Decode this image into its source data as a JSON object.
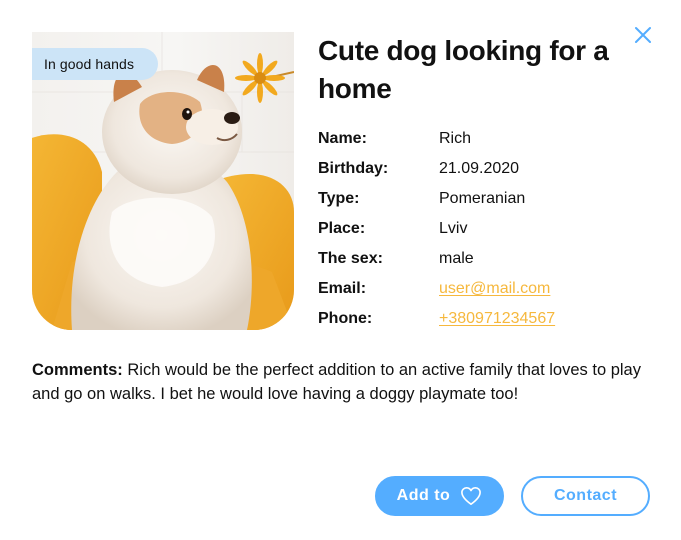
{
  "modal": {
    "title": "Cute dog looking for a home",
    "badge": "In good hands",
    "photo_alt": "Pomeranian dog looking at a yellow flower",
    "details": [
      {
        "label": "Name:",
        "value": "Rich"
      },
      {
        "label": "Birthday:",
        "value": "21.09.2020"
      },
      {
        "label": "Type:",
        "value": "Pomeranian"
      },
      {
        "label": "Place:",
        "value": "Lviv"
      },
      {
        "label": "The sex:",
        "value": "male"
      },
      {
        "label": "Email:",
        "value": "user@mail.com"
      },
      {
        "label": "Phone:",
        "value": "+380971234567"
      }
    ],
    "comments_label": "Comments:",
    "comments_text": "Rich would be the perfect addition to an active family that loves to play and go on walks. I bet he would love having a doggy playmate too!",
    "buttons": {
      "add_label": "Add to",
      "contact_label": "Contact"
    },
    "icons": {
      "close": "close-icon",
      "heart": "heart-icon"
    },
    "colors": {
      "accent": "#54adff",
      "link": "#f6b83d",
      "badge_bg": "#cce4f7"
    }
  }
}
